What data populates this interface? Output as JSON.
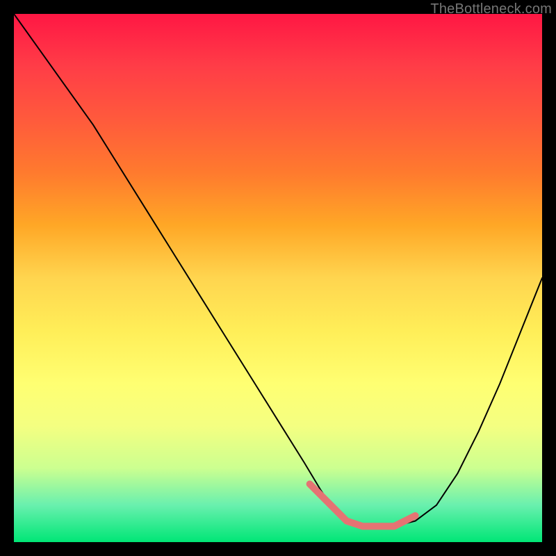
{
  "watermark": "TheBottleneck.com",
  "chart_data": {
    "type": "line",
    "title": "",
    "xlabel": "",
    "ylabel": "",
    "xlim": [
      0,
      100
    ],
    "ylim": [
      0,
      100
    ],
    "grid": false,
    "legend": false,
    "series": [
      {
        "name": "bottleneck-curve",
        "color": "#000000",
        "stroke_width": 2,
        "x": [
          0,
          5,
          10,
          15,
          20,
          25,
          30,
          35,
          40,
          45,
          50,
          55,
          58,
          60,
          63,
          66,
          69,
          72,
          76,
          80,
          84,
          88,
          92,
          96,
          100
        ],
        "y": [
          100,
          93,
          86,
          79,
          71,
          63,
          55,
          47,
          39,
          31,
          23,
          15,
          10,
          7,
          4,
          3,
          3,
          3,
          4,
          7,
          13,
          21,
          30,
          40,
          50
        ]
      },
      {
        "name": "optimal-band",
        "color": "#e57373",
        "stroke_width": 10,
        "x": [
          56,
          58,
          60,
          63,
          66,
          69,
          72,
          74,
          76
        ],
        "y": [
          11,
          9,
          7,
          4,
          3,
          3,
          3,
          4,
          5
        ]
      }
    ],
    "annotations": []
  }
}
